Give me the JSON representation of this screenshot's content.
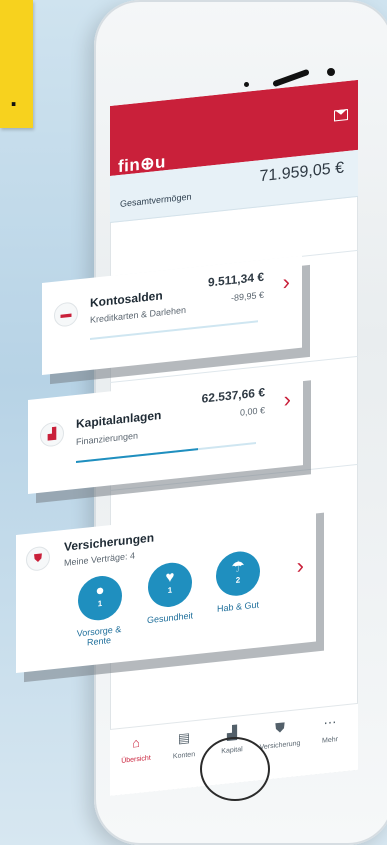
{
  "app": {
    "brand": "fin⊕u"
  },
  "header": {
    "mail_icon": "mail-icon"
  },
  "overview": {
    "label": "Gesamtvermögen",
    "total": "71.959,05 €"
  },
  "cards": [
    {
      "title": "Kontosalden",
      "subtitle": "Kreditkarten & Darlehen",
      "amount": "9.511,34 €",
      "delta": "-89,95 €",
      "icon": "card-icon"
    },
    {
      "title": "Kapitalanlagen",
      "subtitle": "Finanzierungen",
      "amount": "62.537,66 €",
      "delta": "0,00 €",
      "icon": "chart-icon"
    }
  ],
  "insurance": {
    "title": "Versicherungen",
    "subtitle": "Meine Verträge: 4",
    "items": [
      {
        "label": "Vorsorge &\nRente",
        "count": "1",
        "icon": "person-icon"
      },
      {
        "label": "Gesundheit",
        "count": "1",
        "icon": "heart-icon"
      },
      {
        "label": "Hab & Gut",
        "count": "2",
        "icon": "umbrella-icon"
      }
    ]
  },
  "tabs": [
    {
      "label": "Übersicht",
      "icon": "home-icon",
      "active": true
    },
    {
      "label": "Konten",
      "icon": "wallet-icon",
      "active": false
    },
    {
      "label": "Kapital",
      "icon": "chart-icon",
      "active": false
    },
    {
      "label": "Versicherung",
      "icon": "shield-icon",
      "active": false
    },
    {
      "label": "Mehr",
      "icon": "more-icon",
      "active": false
    }
  ],
  "colors": {
    "brand": "#c9203a",
    "accent": "#1f8fbf",
    "promo": "#f7d21e"
  }
}
